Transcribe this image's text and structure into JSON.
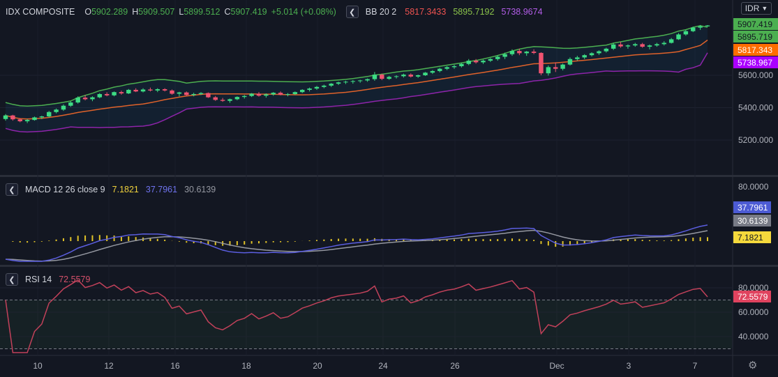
{
  "main": {
    "symbol": "IDX COMPOSITE",
    "ohlc": {
      "o_label": "O",
      "o": "5902.289",
      "h_label": "H",
      "h": "5909.507",
      "l_label": "L",
      "l": "5899.512",
      "c_label": "C",
      "c": "5907.419",
      "change": "+5.014 (+0.08%)"
    },
    "bb": {
      "label": "BB 20 2",
      "basis": "5817.3433",
      "upper": "5895.7192",
      "lower": "5738.9674"
    },
    "currency": "IDR"
  },
  "macd_legend": {
    "label": "MACD 12 26 close 9",
    "hist": "7.1821",
    "macd": "37.7961",
    "signal": "30.6139"
  },
  "rsi_legend": {
    "label": "RSI 14",
    "value": "72.5579"
  },
  "icons": {
    "collapse": "chevron-left-icon",
    "settings": "gear-icon"
  },
  "colors": {
    "up": "#26a69a",
    "up_candle": "#3ddc84",
    "down": "#ef5370",
    "bb_upper": "#4caf50",
    "bb_basis": "#e0622a",
    "bb_lower": "#8e24aa",
    "macd": "#5b5ee0",
    "signal": "#9598a1",
    "hist": "#e0c228",
    "rsi": "#c2415a",
    "close_tag": "#4caf50",
    "basis_tag": "#ff6d00",
    "lower_tag": "#aa00ff",
    "macd_tag": "#4c5bd4",
    "signal_tag": "#787b86",
    "hist_tag": "#f5d93c",
    "rsi_tag": "#e0435f"
  },
  "chart_data": [
    {
      "type": "candlestick",
      "title": "IDX COMPOSITE",
      "x_tick_labels": [
        "10",
        "12",
        "16",
        "18",
        "20",
        "24",
        "26",
        "Dec",
        "3",
        "7"
      ],
      "y_ticks": [
        5200,
        5400,
        5600
      ],
      "y_tick_labels": [
        "5200.000",
        "5400.000",
        "5600.000"
      ],
      "ylim": [
        5095,
        5745
      ],
      "price_tags": [
        {
          "name": "close",
          "value": 5907.419,
          "label": "5907.419"
        },
        {
          "name": "bb_upper",
          "value": 5895.719,
          "label": "5895.719"
        },
        {
          "name": "bb_basis",
          "value": 5817.343,
          "label": "5817.343"
        },
        {
          "name": "bb_lower",
          "value": 5738.967,
          "label": "5738.967"
        }
      ],
      "candles": [
        [
          5330,
          5360,
          5320,
          5352
        ],
        [
          5352,
          5356,
          5320,
          5328
        ],
        [
          5328,
          5335,
          5310,
          5316
        ],
        [
          5316,
          5330,
          5305,
          5324
        ],
        [
          5324,
          5345,
          5320,
          5340
        ],
        [
          5340,
          5350,
          5330,
          5346
        ],
        [
          5346,
          5380,
          5340,
          5373
        ],
        [
          5373,
          5395,
          5365,
          5388
        ],
        [
          5388,
          5420,
          5380,
          5412
        ],
        [
          5412,
          5440,
          5405,
          5432
        ],
        [
          5432,
          5470,
          5425,
          5462
        ],
        [
          5462,
          5478,
          5445,
          5452
        ],
        [
          5452,
          5470,
          5440,
          5464
        ],
        [
          5464,
          5490,
          5458,
          5484
        ],
        [
          5484,
          5495,
          5470,
          5476
        ],
        [
          5476,
          5500,
          5470,
          5496
        ],
        [
          5496,
          5505,
          5480,
          5488
        ],
        [
          5488,
          5515,
          5484,
          5510
        ],
        [
          5510,
          5520,
          5496,
          5500
        ],
        [
          5500,
          5520,
          5494,
          5512
        ],
        [
          5512,
          5524,
          5500,
          5506
        ],
        [
          5506,
          5520,
          5496,
          5514
        ],
        [
          5514,
          5520,
          5500,
          5506
        ],
        [
          5506,
          5512,
          5480,
          5486
        ],
        [
          5486,
          5498,
          5470,
          5494
        ],
        [
          5494,
          5500,
          5474,
          5478
        ],
        [
          5478,
          5492,
          5470,
          5484
        ],
        [
          5484,
          5496,
          5478,
          5490
        ],
        [
          5490,
          5494,
          5460,
          5464
        ],
        [
          5464,
          5472,
          5442,
          5448
        ],
        [
          5448,
          5460,
          5436,
          5442
        ],
        [
          5442,
          5456,
          5430,
          5452
        ],
        [
          5452,
          5470,
          5446,
          5466
        ],
        [
          5466,
          5478,
          5456,
          5472
        ],
        [
          5472,
          5490,
          5466,
          5486
        ],
        [
          5486,
          5496,
          5468,
          5474
        ],
        [
          5474,
          5488,
          5462,
          5482
        ],
        [
          5482,
          5496,
          5474,
          5492
        ],
        [
          5492,
          5500,
          5476,
          5480
        ],
        [
          5480,
          5490,
          5470,
          5484
        ],
        [
          5484,
          5500,
          5478,
          5496
        ],
        [
          5496,
          5514,
          5490,
          5510
        ],
        [
          5510,
          5524,
          5500,
          5518
        ],
        [
          5518,
          5534,
          5510,
          5528
        ],
        [
          5528,
          5542,
          5520,
          5536
        ],
        [
          5536,
          5552,
          5528,
          5548
        ],
        [
          5548,
          5560,
          5540,
          5556
        ],
        [
          5556,
          5566,
          5546,
          5560
        ],
        [
          5560,
          5570,
          5548,
          5564
        ],
        [
          5564,
          5572,
          5554,
          5568
        ],
        [
          5568,
          5580,
          5560,
          5576
        ],
        [
          5576,
          5620,
          5566,
          5604
        ],
        [
          5604,
          5610,
          5570,
          5578
        ],
        [
          5578,
          5596,
          5572,
          5590
        ],
        [
          5590,
          5600,
          5580,
          5594
        ],
        [
          5594,
          5610,
          5586,
          5604
        ],
        [
          5604,
          5612,
          5586,
          5592
        ],
        [
          5592,
          5604,
          5584,
          5600
        ],
        [
          5600,
          5620,
          5596,
          5616
        ],
        [
          5616,
          5632,
          5608,
          5626
        ],
        [
          5626,
          5646,
          5618,
          5640
        ],
        [
          5640,
          5656,
          5632,
          5650
        ],
        [
          5650,
          5664,
          5640,
          5656
        ],
        [
          5656,
          5676,
          5648,
          5670
        ],
        [
          5670,
          5700,
          5662,
          5690
        ],
        [
          5690,
          5700,
          5672,
          5680
        ],
        [
          5680,
          5696,
          5670,
          5690
        ],
        [
          5690,
          5706,
          5682,
          5700
        ],
        [
          5700,
          5722,
          5690,
          5714
        ],
        [
          5714,
          5740,
          5700,
          5730
        ],
        [
          5730,
          5760,
          5720,
          5750
        ],
        [
          5750,
          5764,
          5724,
          5736
        ],
        [
          5736,
          5750,
          5720,
          5746
        ],
        [
          5746,
          5760,
          5730,
          5738
        ],
        [
          5738,
          5742,
          5600,
          5612
        ],
        [
          5612,
          5660,
          5598,
          5650
        ],
        [
          5650,
          5680,
          5620,
          5640
        ],
        [
          5640,
          5672,
          5630,
          5666
        ],
        [
          5666,
          5710,
          5660,
          5700
        ],
        [
          5700,
          5720,
          5690,
          5710
        ],
        [
          5710,
          5730,
          5700,
          5724
        ],
        [
          5724,
          5742,
          5716,
          5736
        ],
        [
          5736,
          5754,
          5726,
          5748
        ],
        [
          5748,
          5770,
          5740,
          5764
        ],
        [
          5764,
          5800,
          5756,
          5790
        ],
        [
          5790,
          5806,
          5770,
          5778
        ],
        [
          5778,
          5790,
          5764,
          5784
        ],
        [
          5784,
          5800,
          5776,
          5792
        ],
        [
          5792,
          5800,
          5770,
          5776
        ],
        [
          5776,
          5790,
          5760,
          5784
        ],
        [
          5784,
          5800,
          5776,
          5792
        ],
        [
          5792,
          5810,
          5784,
          5800
        ],
        [
          5800,
          5830,
          5796,
          5822
        ],
        [
          5822,
          5860,
          5818,
          5852
        ],
        [
          5852,
          5880,
          5844,
          5872
        ],
        [
          5872,
          5900,
          5866,
          5894
        ],
        [
          5894,
          5910,
          5880,
          5902
        ],
        [
          5902,
          5909.507,
          5899.512,
          5907.419
        ]
      ]
    },
    {
      "type": "line",
      "title": "MACD 12 26 close 9",
      "y_ticks": [
        80
      ],
      "y_tick_labels": [
        "80.0000"
      ],
      "price_tags": [
        {
          "name": "macd",
          "value": 37.7961,
          "label": "37.7961"
        },
        {
          "name": "signal",
          "value": 30.6139,
          "label": "30.6139"
        },
        {
          "name": "histogram",
          "value": 7.1821,
          "label": "7.1821"
        }
      ]
    },
    {
      "type": "line",
      "title": "RSI 14",
      "y_ticks": [
        40,
        60,
        80
      ],
      "y_tick_labels": [
        "40.0000",
        "60.0000",
        "80.0000"
      ],
      "ylim": [
        24,
        95
      ],
      "bands": [
        30,
        70
      ],
      "price_tags": [
        {
          "name": "rsi",
          "value": 72.5579,
          "label": "72.5579"
        }
      ]
    }
  ]
}
